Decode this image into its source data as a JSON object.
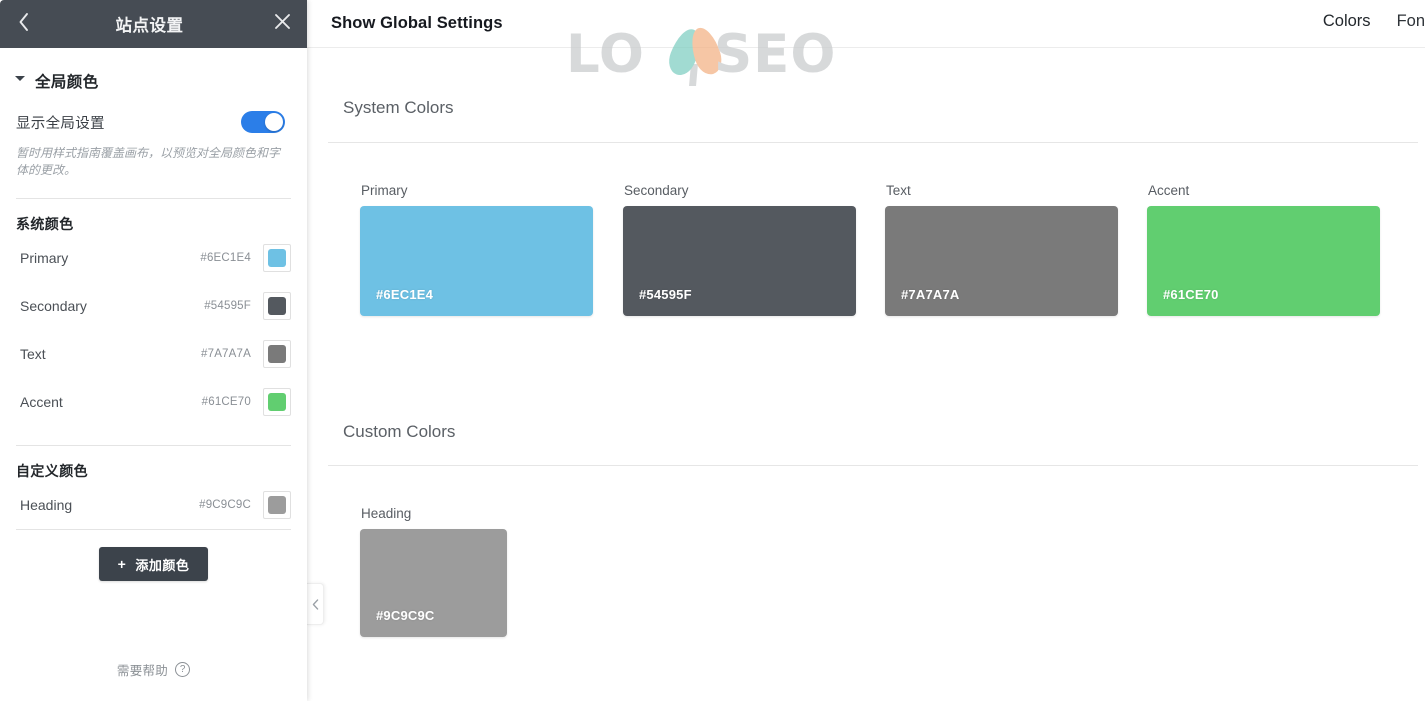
{
  "canvas": {
    "topbar": {
      "title": "Show Global Settings",
      "nav": [
        {
          "label": "Colors"
        },
        {
          "label": "Fon"
        }
      ]
    },
    "watermark": {
      "part_left": "LO",
      "part_right": "SEO",
      "petal_teal_color": "#7ecec1",
      "petal_orange_color": "#f3b183",
      "text_color": "#c9cbcd"
    },
    "system_section": {
      "title": "System Colors",
      "swatches": [
        {
          "label": "Primary",
          "hex": "#6EC1E4",
          "color": "#6ec1e4"
        },
        {
          "label": "Secondary",
          "hex": "#54595F",
          "color": "#54595f"
        },
        {
          "label": "Text",
          "hex": "#7A7A7A",
          "color": "#7a7a7a"
        },
        {
          "label": "Accent",
          "hex": "#61CE70",
          "color": "#61ce70"
        }
      ]
    },
    "custom_section": {
      "title": "Custom Colors",
      "swatches": [
        {
          "label": "Heading",
          "hex": "#9C9C9C",
          "color": "#9c9c9c"
        }
      ]
    },
    "collapse_handle_icon": "chevron-left-icon"
  },
  "sidebar": {
    "header": {
      "back_icon": "chevron-left-icon",
      "title": "站点设置",
      "close_icon": "close-icon",
      "background": "#464c54"
    },
    "accordion": {
      "label": "全局颜色",
      "caret_icon": "caret-down-icon"
    },
    "global_toggle": {
      "label": "显示全局设置",
      "state": "on",
      "accent": "#2b7ee8"
    },
    "note": "暂时用样式指南覆盖画布，以预览对全局颜色和字体的更改。",
    "system_group": {
      "title": "系统颜色",
      "items": [
        {
          "name": "Primary",
          "hex": "#6EC1E4",
          "color": "#6ec1e4"
        },
        {
          "name": "Secondary",
          "hex": "#54595F",
          "color": "#54595f"
        },
        {
          "name": "Text",
          "hex": "#7A7A7A",
          "color": "#7a7a7a"
        },
        {
          "name": "Accent",
          "hex": "#61CE70",
          "color": "#61ce70"
        }
      ]
    },
    "custom_group": {
      "title": "自定义颜色",
      "items": [
        {
          "name": "Heading",
          "hex": "#9C9C9C",
          "color": "#9c9c9c"
        }
      ]
    },
    "add_button": {
      "plus": "+",
      "label": "添加颜色"
    },
    "footer": {
      "label": "需要帮助",
      "icon": "question-mark-icon",
      "glyph": "?"
    }
  }
}
